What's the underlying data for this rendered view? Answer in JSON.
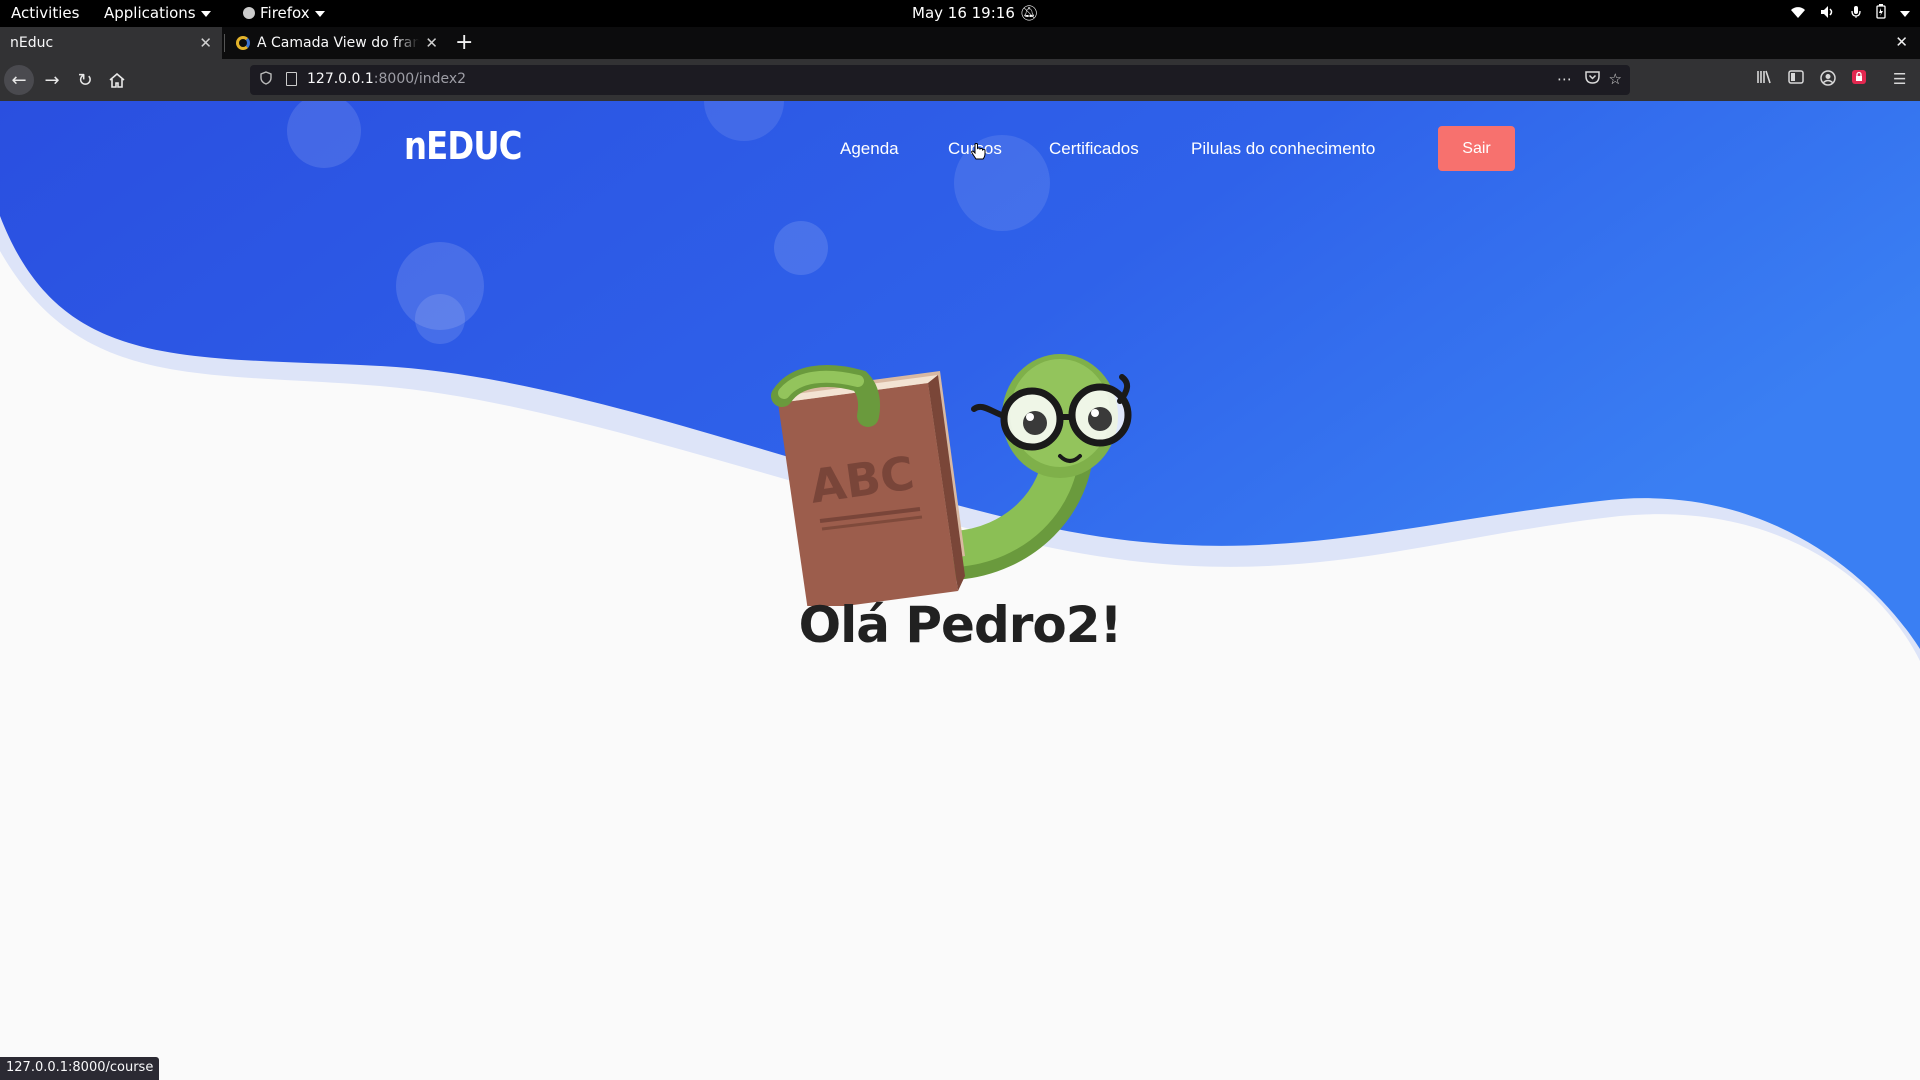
{
  "os_bar": {
    "activities": "Activities",
    "applications": "Applications",
    "app_name": "Firefox",
    "datetime": "May 16  19:16"
  },
  "browser": {
    "tabs": [
      {
        "title": "nEduc",
        "active": true
      },
      {
        "title": "A Camada View do frame",
        "active": false
      }
    ],
    "url_host": "127.0.0.1",
    "url_path": ":8000/index2",
    "status_url": "127.0.0.1:8000/course"
  },
  "site": {
    "logo": "nEDUC",
    "nav": {
      "agenda": "Agenda",
      "cursos": "Cursos",
      "certificados": "Certificados",
      "pilulas": "Pilulas do conhecimento"
    },
    "logout_label": "Sair",
    "greeting": "Olá Pedro2!",
    "mascot_book_text": "ABC"
  },
  "colors": {
    "hero_blue": "#2f5ce6",
    "hero_blue_light": "#3d7cf2",
    "button_coral": "#f7716e",
    "page_bg": "#fafafa"
  }
}
